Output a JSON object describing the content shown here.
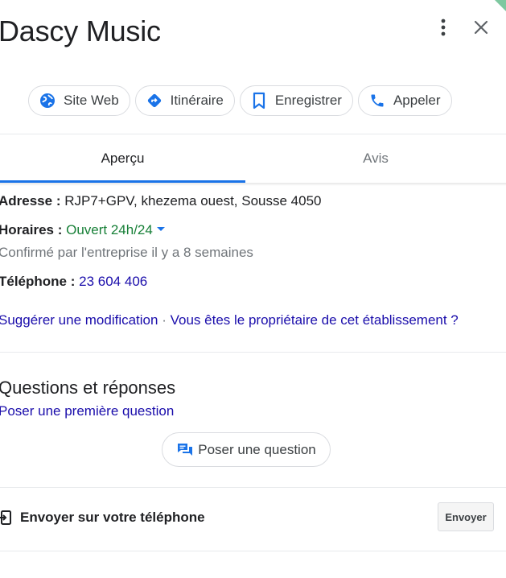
{
  "header": {
    "title": "Dascy Music",
    "more_icon": "more-vert-icon",
    "close_icon": "close-icon"
  },
  "actions": [
    {
      "label": "Site Web",
      "icon": "globe-icon"
    },
    {
      "label": "Itinéraire",
      "icon": "directions-icon"
    },
    {
      "label": "Enregistrer",
      "icon": "bookmark-icon"
    },
    {
      "label": "Appeler",
      "icon": "phone-icon"
    }
  ],
  "tabs": [
    {
      "label": "Aperçu",
      "active": true
    },
    {
      "label": "Avis",
      "active": false
    }
  ],
  "info": {
    "address_label": "Adresse :",
    "address_value": "RJP7+GPV, khezema ouest, Sousse 4050",
    "hours_label": "Horaires :",
    "hours_value": "Ouvert 24h/24",
    "confirmed": "Confirmé par l'entreprise il y a 8 semaines",
    "phone_label": "Téléphone :",
    "phone_value": "23 604 406",
    "suggest_link": "Suggérer une modification",
    "separator": "·",
    "owner_link": "Vous êtes le propriétaire de cet établissement ?"
  },
  "qa": {
    "title": "Questions et réponses",
    "first_question_link": "Poser une première question",
    "ask_button": "Poser une question"
  },
  "send": {
    "label": "Envoyer sur votre téléphone",
    "button": "Envoyer"
  },
  "colors": {
    "accent": "#1a73e8",
    "link": "#1a0dab",
    "open": "#188038"
  }
}
